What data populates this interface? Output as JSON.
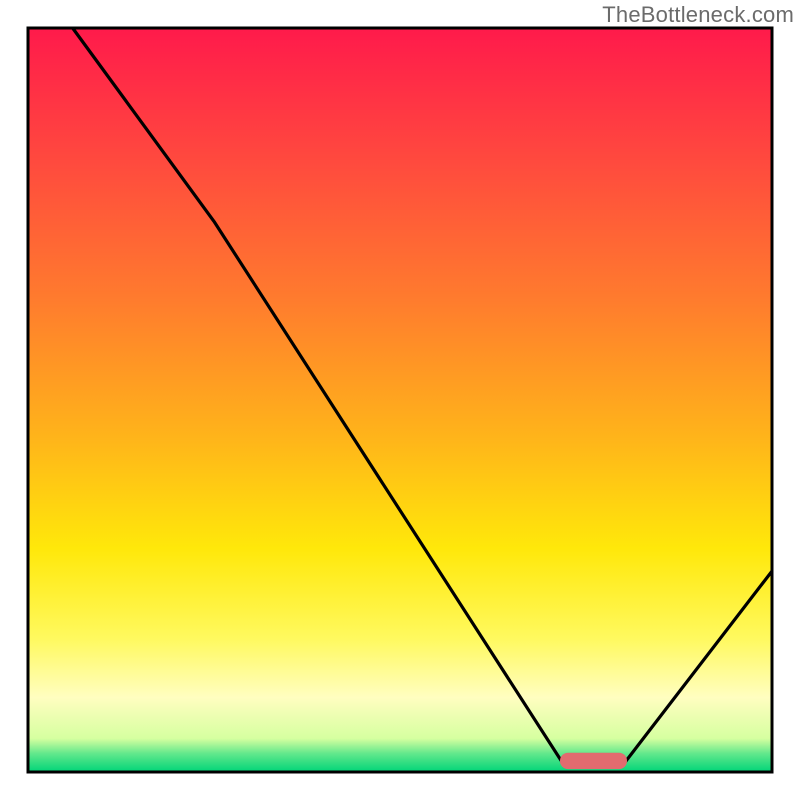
{
  "watermark": "TheBottleneck.com",
  "chart_data": {
    "type": "line",
    "title": "",
    "xlabel": "",
    "ylabel": "",
    "xlim": [
      0,
      100
    ],
    "ylim": [
      0,
      100
    ],
    "grid": false,
    "legend": false,
    "background_gradient": {
      "stops": [
        {
          "offset": 0.0,
          "color": "#ff1a4b"
        },
        {
          "offset": 0.18,
          "color": "#ff4a3e"
        },
        {
          "offset": 0.36,
          "color": "#ff7a2e"
        },
        {
          "offset": 0.55,
          "color": "#ffb41a"
        },
        {
          "offset": 0.7,
          "color": "#ffe80a"
        },
        {
          "offset": 0.82,
          "color": "#fff95e"
        },
        {
          "offset": 0.9,
          "color": "#fffec0"
        },
        {
          "offset": 0.955,
          "color": "#d6ffa0"
        },
        {
          "offset": 0.975,
          "color": "#63e88c"
        },
        {
          "offset": 1.0,
          "color": "#00d478"
        }
      ]
    },
    "curve": {
      "x": [
        6,
        25,
        72,
        80,
        100
      ],
      "y": [
        100,
        74,
        1,
        1,
        27
      ]
    },
    "marker": {
      "shape": "rounded_bar",
      "x_center": 76,
      "y": 1.5,
      "width": 9,
      "height": 2.2,
      "color": "#e26b6f"
    },
    "annotations": []
  }
}
